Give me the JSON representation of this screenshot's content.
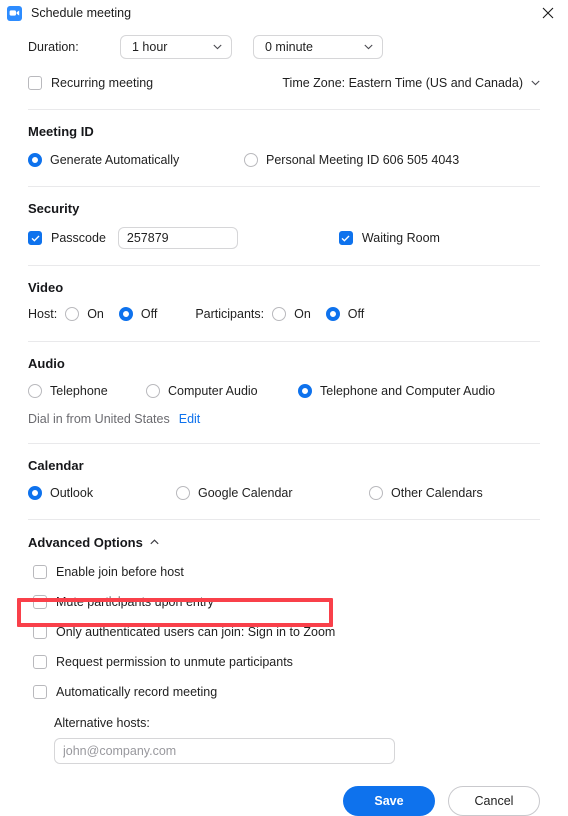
{
  "window": {
    "title": "Schedule meeting",
    "logo_icon": "zoom-camera-icon",
    "close_icon": "close-icon"
  },
  "duration": {
    "label": "Duration:",
    "hours_value": "1 hour",
    "minutes_value": "0 minute",
    "chevron_icon": "chevron-down-icon"
  },
  "recurring": {
    "label": "Recurring meeting",
    "checked": false
  },
  "timezone": {
    "label": "Time Zone: Eastern Time (US and Canada)",
    "chevron_icon": "chevron-down-icon"
  },
  "meeting_id": {
    "title": "Meeting ID",
    "options": [
      {
        "label": "Generate Automatically",
        "selected": true
      },
      {
        "label": "Personal Meeting ID 606 505 4043",
        "selected": false
      }
    ]
  },
  "security": {
    "title": "Security",
    "passcode_label": "Passcode",
    "passcode_checked": true,
    "passcode_value": "257879",
    "waiting_room_label": "Waiting Room",
    "waiting_room_checked": true
  },
  "video": {
    "title": "Video",
    "host_label": "Host:",
    "host_on": "On",
    "host_off": "Off",
    "host_selected": "Off",
    "participants_label": "Participants:",
    "participants_on": "On",
    "participants_off": "Off",
    "participants_selected": "Off"
  },
  "audio": {
    "title": "Audio",
    "options": [
      {
        "label": "Telephone",
        "selected": false
      },
      {
        "label": "Computer Audio",
        "selected": false
      },
      {
        "label": "Telephone and Computer Audio",
        "selected": true
      }
    ],
    "dial_in_text": "Dial in from United States",
    "edit_link": "Edit"
  },
  "calendar": {
    "title": "Calendar",
    "options": [
      {
        "label": "Outlook",
        "selected": true
      },
      {
        "label": "Google Calendar",
        "selected": false
      },
      {
        "label": "Other Calendars",
        "selected": false
      }
    ]
  },
  "advanced": {
    "title": "Advanced Options",
    "caret_icon": "chevron-up-icon",
    "options": [
      {
        "label": "Enable join before host",
        "checked": false
      },
      {
        "label": "Mute participants upon entry",
        "checked": false
      },
      {
        "label": "Only authenticated users can join: Sign in to Zoom",
        "checked": false
      },
      {
        "label": "Request permission to unmute participants",
        "checked": false,
        "highlighted": true
      },
      {
        "label": "Automatically record meeting",
        "checked": false
      }
    ],
    "alternative_hosts_label": "Alternative hosts:",
    "alternative_hosts_value": "",
    "alternative_hosts_placeholder": "john@company.com"
  },
  "footer": {
    "save_label": "Save",
    "cancel_label": "Cancel"
  },
  "colors": {
    "accent": "#0e72ed",
    "logo": "#2D8CFF",
    "highlight": "#f9404a",
    "divider": "#e9e9eb"
  }
}
